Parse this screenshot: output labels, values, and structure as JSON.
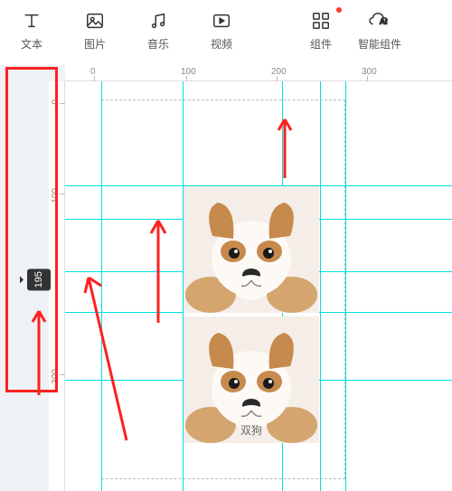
{
  "toolbar": {
    "text_label": "文本",
    "image_label": "图片",
    "music_label": "音乐",
    "video_label": "视频",
    "component_label": "组件",
    "ai_component_label": "智能组件"
  },
  "ruler": {
    "top_marks": [
      "0",
      "100",
      "200",
      "300"
    ],
    "left_marks": [
      "0",
      "100",
      "300"
    ],
    "position_marker": "195"
  },
  "canvas": {
    "image_label": "双狗"
  },
  "colors": {
    "annotation_red": "#ff2020",
    "guide_cyan": "#00e0e0",
    "dog_brown": "#c68a4d",
    "dog_cream": "#f5ede8"
  }
}
